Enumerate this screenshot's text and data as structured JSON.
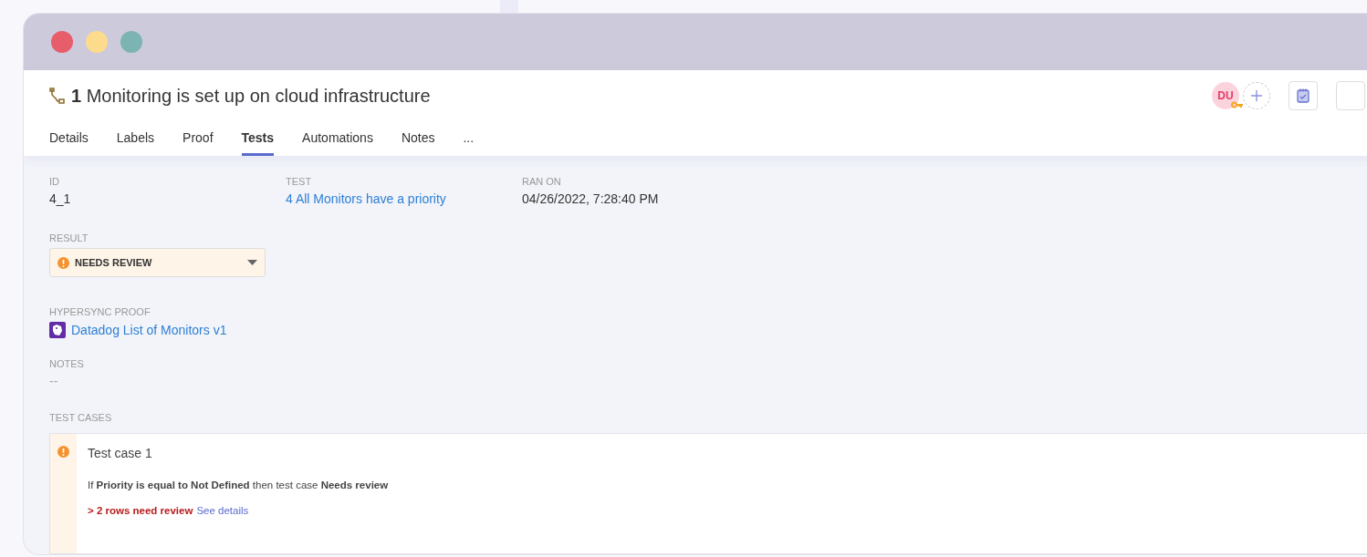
{
  "window": {
    "controls": [
      {
        "color": "#e85d6a"
      },
      {
        "color": "#fcdc8c"
      },
      {
        "color": "#7cb3b3"
      }
    ]
  },
  "header": {
    "number": "1",
    "title": "Monitoring is set up on cloud infrastructure",
    "avatar": {
      "initials": "DU"
    }
  },
  "tabs": [
    {
      "label": "Details",
      "selected": false
    },
    {
      "label": "Labels",
      "selected": false
    },
    {
      "label": "Proof",
      "selected": false
    },
    {
      "label": "Tests",
      "selected": true
    },
    {
      "label": "Automations",
      "selected": false
    },
    {
      "label": "Notes",
      "selected": false
    },
    {
      "label": "...",
      "selected": false
    }
  ],
  "fields": [
    {
      "label": "ID",
      "value": "4_1",
      "kind": "text"
    },
    {
      "label": "TEST",
      "value": "4 All Monitors have a priority",
      "kind": "link"
    },
    {
      "label": "RAN ON",
      "value": "04/26/2022, 7:28:40 PM",
      "kind": "text"
    }
  ],
  "result": {
    "label": "RESULT",
    "value": "NEEDS REVIEW",
    "kind": "needs_review"
  },
  "proof": {
    "label": "HYPERSYNC PROOF",
    "value": "Datadog List of Monitors v1"
  },
  "notes": {
    "label": "NOTES",
    "value": "--"
  },
  "test_cases": {
    "label": "TEST CASES",
    "items": [
      {
        "kind": "needs_review",
        "title": "Test case 1",
        "rule": "If **Priority is equal to Not Defined** then test case **Needs review**",
        "warning": "> 2 rows need review",
        "link": "See details"
      }
    ]
  }
}
